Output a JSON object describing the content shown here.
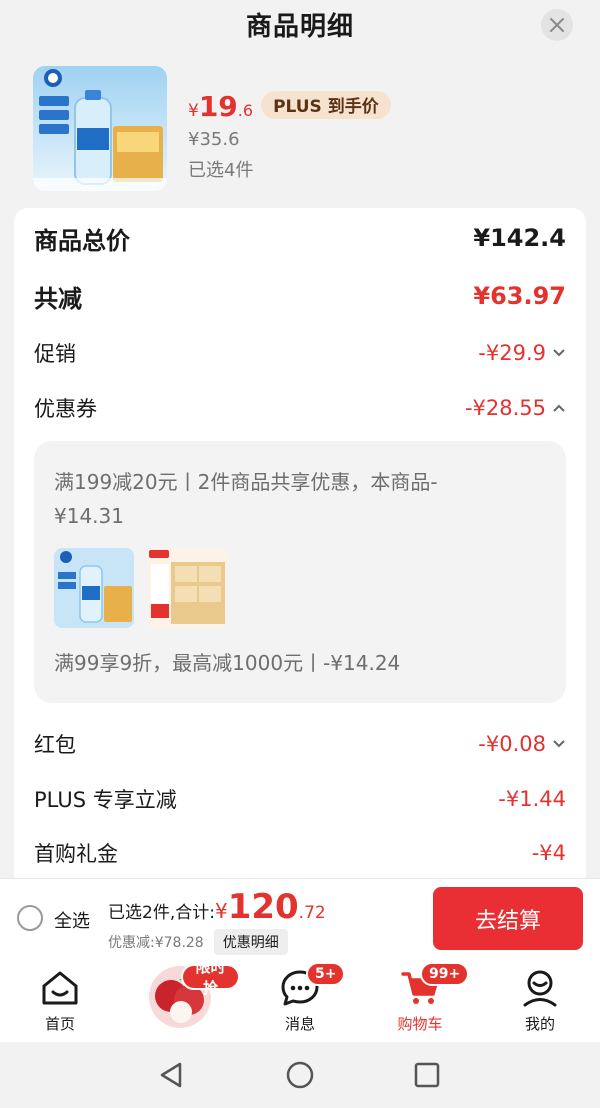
{
  "header": {
    "title": "商品明细"
  },
  "product": {
    "price_yen": "¥",
    "price_int": "19",
    "price_dec": ".6",
    "plus_badge": "PLUS 到手价",
    "original_price": "¥35.6",
    "selected_count": "已选4件"
  },
  "summary": {
    "total": {
      "label": "商品总价",
      "value": "¥142.4"
    },
    "reduced": {
      "label": "共减",
      "value": "¥63.97"
    },
    "promo": {
      "label": "促销",
      "value": "-¥29.9"
    },
    "coupon": {
      "label": "优惠券",
      "value": "-¥28.55"
    },
    "red_packet": {
      "label": "红包",
      "value": "-¥0.08"
    },
    "plus": {
      "label": "PLUS 专享立减",
      "value": "-¥1.44"
    },
    "first_purchase": {
      "label": "首购礼金",
      "value": "-¥4"
    }
  },
  "coupon_detail": {
    "line1": "满199减20元丨2件商品共享优惠，本商品-¥14.31",
    "line2": "满99享9折，最高减1000元丨-¥14.24"
  },
  "checkout": {
    "select_all": "全选",
    "total_prefix": "已选2件,合计:",
    "total_yen": "¥",
    "total_int": "120",
    "total_dec": ".72",
    "discount_text": "优惠减:¥78.28",
    "detail_button": "优惠明细",
    "checkout_button": "去结算"
  },
  "tabbar": {
    "home": "首页",
    "promo_tag": "限时抢",
    "messages": "消息",
    "messages_badge": "5+",
    "cart": "购物车",
    "cart_badge": "99+",
    "me": "我的"
  },
  "colors": {
    "accent": "#e4322e",
    "checkout": "#ea2f34",
    "plus_badge_bg": "#f6e3cf"
  }
}
